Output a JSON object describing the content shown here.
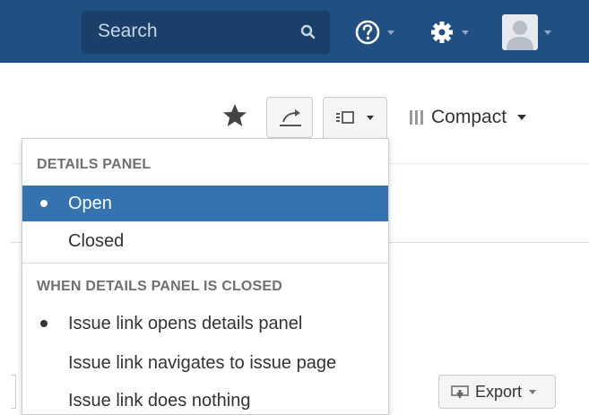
{
  "header": {
    "search_placeholder": "Search",
    "help_icon": "help-icon",
    "settings_icon": "gear-icon",
    "profile_icon": "avatar",
    "bg_color": "#205081"
  },
  "toolbar": {
    "star_icon": "star-icon",
    "share_icon": "share-icon",
    "layout_icon": "details-panel-layout-icon",
    "compact_label": "Compact"
  },
  "dropdown": {
    "details_heading": "DETAILS PANEL",
    "details_options": [
      {
        "label": "Open",
        "selected": true
      },
      {
        "label": "Closed",
        "selected": false
      }
    ],
    "closed_heading": "WHEN DETAILS PANEL IS CLOSED",
    "closed_options": [
      {
        "label": "Issue link opens details panel",
        "selected": true
      },
      {
        "label": "Issue link navigates to issue page",
        "selected": false
      },
      {
        "label": "Issue link does nothing",
        "selected": false
      }
    ],
    "selected_color": "#3572b0"
  },
  "export": {
    "label": "Export"
  }
}
